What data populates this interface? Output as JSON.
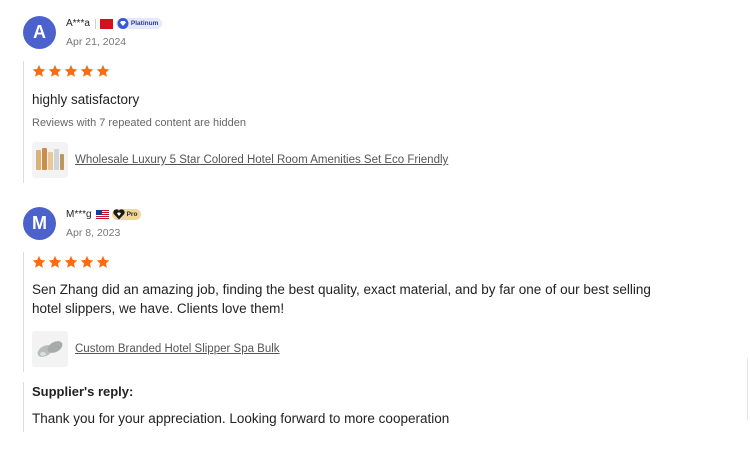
{
  "reviews": [
    {
      "avatar_letter": "A",
      "name": "A***a",
      "flag_country": "China",
      "badge": "Platinum",
      "date": "Apr 21, 2024",
      "rating": 5,
      "text": "highly satisfactory",
      "hidden_note": "Reviews with 7 repeated content are hidden",
      "product": "Wholesale Luxury 5 Star Colored Hotel Room Amenities Set Eco Friendly"
    },
    {
      "avatar_letter": "M",
      "name": "M***g",
      "flag_country": "United States",
      "badge": "Pro",
      "date": "Apr 8, 2023",
      "rating": 5,
      "text_line1": "Sen Zhang did an amazing job, finding the best quality, exact material, and by far one of our best selling",
      "text_line2": "hotel slippers, we have. Clients love them!",
      "product": "Custom Branded Hotel Slipper Spa Bulk",
      "reply_title": "Supplier's reply:",
      "reply_text": "Thank you for your appreciation. Looking forward to more cooperation"
    }
  ],
  "colors": {
    "avatar": "#4b62cc",
    "star": "#fa6c0f",
    "platinum_badge": "#e3e8fb",
    "pro_badge": "#f1d79a"
  },
  "icons": {
    "star": "star-icon",
    "platinum": "diamond-icon",
    "pro": "heart-diamond-icon"
  }
}
